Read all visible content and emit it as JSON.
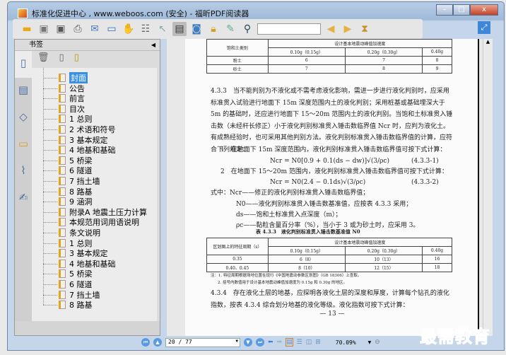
{
  "window": {
    "title": "标准化促进中心 , www.weboos.com (安全) - 福昕PDF阅读器",
    "minimize": "–",
    "maximize": "□",
    "close": "x"
  },
  "toolbar": {
    "icons": [
      "open-folder-icon",
      "save-icon",
      "save-as-icon",
      "print-icon",
      "email-icon",
      "fullscreen-display-icon",
      "hand-tool-icon",
      "text-select-icon",
      "pointer-icon",
      "typewriter-icon",
      "snapshot-icon",
      "security-icon",
      "sign-icon",
      "find-icon",
      "prev-find-icon",
      "next-find-icon",
      "zoom-page-icon"
    ],
    "search_value": ""
  },
  "sidebar": {
    "title": "书签",
    "tabs": [
      "bookmarks",
      "pages",
      "layers",
      "comments",
      "attachments",
      "signatures"
    ],
    "items": [
      {
        "label": "封面",
        "selected": true
      },
      {
        "label": "公告"
      },
      {
        "label": "前言"
      },
      {
        "label": "目次"
      },
      {
        "label": "1 总则"
      },
      {
        "label": "2 术语和符号"
      },
      {
        "label": "3 基本规定"
      },
      {
        "label": "4 地基和基础"
      },
      {
        "label": "5 桥梁"
      },
      {
        "label": "6 隧道"
      },
      {
        "label": "7 挡土墙"
      },
      {
        "label": "8 路基"
      },
      {
        "label": "9 涵洞"
      },
      {
        "label": "附录A 地震土压力计算"
      },
      {
        "label": "本规范用词用语说明"
      },
      {
        "label": "条文说明"
      },
      {
        "label": "1 总则"
      },
      {
        "label": "3 基本规定"
      },
      {
        "label": "4 地基和基础"
      },
      {
        "label": "5 桥梁"
      },
      {
        "label": "6 隧道"
      },
      {
        "label": "7 挡土墙"
      },
      {
        "label": "8 路基"
      }
    ]
  },
  "doc": {
    "table1": {
      "col0": "饱和土类别",
      "group": "设计基本地震动峰值加速度",
      "heads": [
        "0.10g（0.15g）",
        "0.20g（0.30g）",
        "0.40g"
      ],
      "rows": [
        [
          "粉土",
          "6",
          "7",
          "8"
        ],
        [
          "砂土",
          "7",
          "8",
          "9"
        ]
      ]
    },
    "p433": "4.3.3　当不能判别为不液化或不需考虑液化影响，需进一步进行液化判别时，应采用标准贯入试验进行地面下 15m 深度范围内土的液化判别；采用桩基或基础埋深大于 5m 的基础时，还应进行地面下 15～20m 范围内土的液化判别。当饱和土标准贯入锤击数（未经杆长修正）小于液化判别标准贯入锤击数临界值 Ncr 时，应判为液化土。有成熟经验时，也可采用其他判别方法。液化判别标准贯入锤击数临界值的计算，应符合下列规定：",
    "item1": "1　在地面下 15m 深度范围内，液化判别标准贯入锤击数临界值可按下式计算：",
    "eq1": "Ncr = N0[0.9 + 0.1(ds − dw)]√(3/ρc)",
    "eq1_no": "(4.3.3-1)",
    "item2": "2　在地面下 15～20m 范围内，液化判别标准贯入锤击数临界值可按下式计算：",
    "eq2": "Ncr = N0(2.4 − 0.1ds)√(3/ρc)",
    "eq2_no": "(4.3.3-2)",
    "defs": [
      "式中：Ncr——修正的液化判别标准贯入锤击数临界值；",
      "N0——液化判别标准贯入锤击数基准值，应按表 4.3.3 采用；",
      "ds——饱和土标准贯入点深度（m）；",
      "ρc——黏粒含量百分率（%），当小于 3 或为砂土时，应采用 3。"
    ],
    "table2": {
      "caption": "表 4.3.3　液化判别标准贯入锤击数基准值 N0",
      "col0": "区划图上的特征周期（s）",
      "group": "设计基本地震动峰值加速度",
      "heads": [
        "0.10g（0.15g）",
        "0.20g（0.30g）",
        "0.40g"
      ],
      "rows": [
        [
          "0.35",
          "6（8）",
          "10（13）",
          "16"
        ],
        [
          "0.40、0.45",
          "8（10）",
          "12（15）",
          "18"
        ]
      ],
      "notes": [
        "注：1. 特征周期根据场地位置在现行《中国地震动参数区划图》（GB 18306）上查取。",
        "2. 括号内数值用于设计基本地震动峰值加速度为 0.15g 和 0.30g 的地区。"
      ]
    },
    "p434": "4.3.4　存在液化土层的地基，应探明各液化土层的深度和厚度，计算每个钻孔的液化指数，按表 4.3.4 综合划分地基的液化等级。液化指数可按下式计算：",
    "page_footer": "— 13 —"
  },
  "statusbar": {
    "page": "20 / 77",
    "zoom": "70.09%"
  },
  "watermark": "最需教育"
}
